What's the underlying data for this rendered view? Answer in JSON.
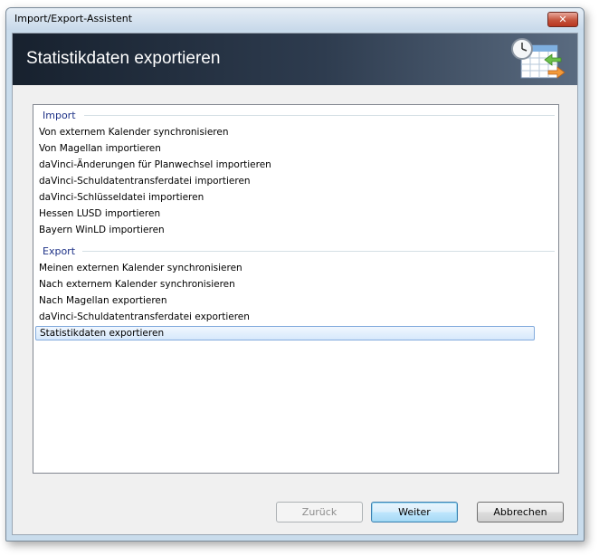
{
  "window": {
    "title": "Import/Export-Assistent",
    "close_label": "✕"
  },
  "banner": {
    "title": "Statistikdaten exportieren",
    "icon": "calendar-clock-export-icon"
  },
  "list": {
    "import_header": "Import",
    "import_items": [
      "Von externem Kalender synchronisieren",
      "Von Magellan importieren",
      "daVinci-Änderungen für Planwechsel importieren",
      "daVinci-Schuldatentransferdatei importieren",
      "daVinci-Schlüsseldatei importieren",
      "Hessen LUSD importieren",
      "Bayern WinLD importieren"
    ],
    "export_header": "Export",
    "export_items": [
      "Meinen externen Kalender synchronisieren",
      "Nach externem Kalender synchronisieren",
      "Nach Magellan exportieren",
      "daVinci-Schuldatentransferdatei exportieren",
      "Statistikdaten exportieren"
    ],
    "selected_item": "Statistikdaten exportieren"
  },
  "buttons": {
    "back": "Zurück",
    "next": "Weiter",
    "cancel": "Abbrechen"
  },
  "colors": {
    "group_header": "#1e3287",
    "banner_dark": "#17212e",
    "selection_border": "#84acdd"
  }
}
